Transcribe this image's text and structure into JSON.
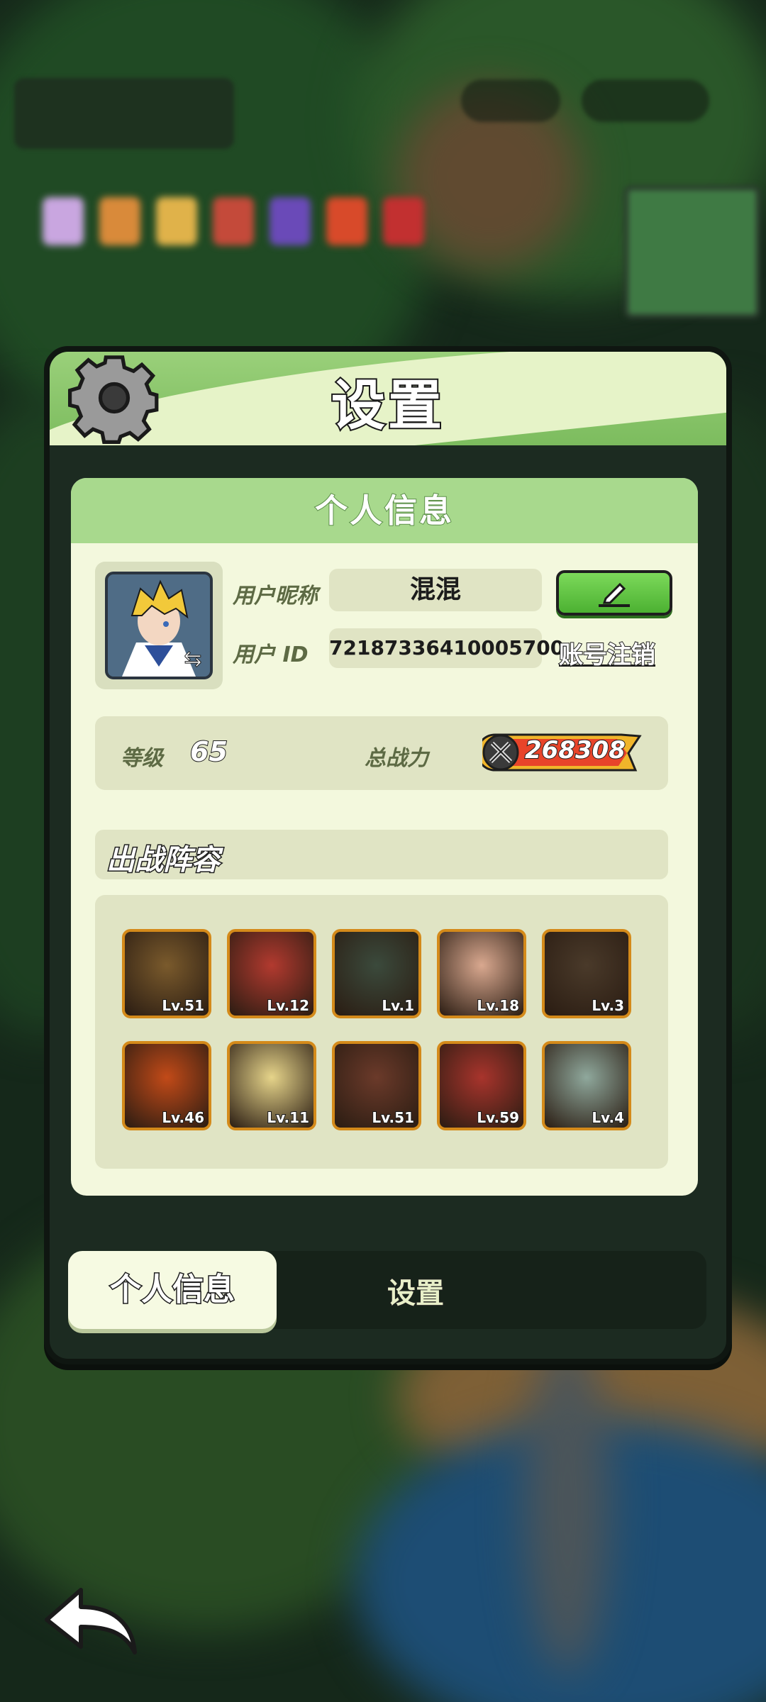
{
  "panel": {
    "title": "设置",
    "section_title": "个人信息"
  },
  "profile": {
    "nickname_label": "用户昵称",
    "nickname_value": "混混",
    "id_label": "用户 ID",
    "id_value": "72187336410005700",
    "logout_label": "账号注销",
    "edit_icon": "pencil-icon"
  },
  "stats": {
    "level_label": "等级",
    "level_value": "65",
    "power_label": "总战力",
    "power_value": "268308"
  },
  "lineup": {
    "title": "出战阵容",
    "heroes": [
      {
        "level": "Lv.51",
        "color": "#7a5a2c"
      },
      {
        "level": "Lv.12",
        "color": "#b23a2f"
      },
      {
        "level": "Lv.1",
        "color": "#3b4a3c"
      },
      {
        "level": "Lv.18",
        "color": "#d9a88f"
      },
      {
        "level": "Lv.3",
        "color": "#4a3a2a"
      },
      {
        "level": "Lv.46",
        "color": "#c24a18"
      },
      {
        "level": "Lv.11",
        "color": "#e6d48a"
      },
      {
        "level": "Lv.51",
        "color": "#6b3a2a"
      },
      {
        "level": "Lv.59",
        "color": "#a8342c"
      },
      {
        "level": "Lv.4",
        "color": "#8fa89c"
      }
    ]
  },
  "tabs": {
    "active": "个人信息",
    "inactive": "设置"
  }
}
